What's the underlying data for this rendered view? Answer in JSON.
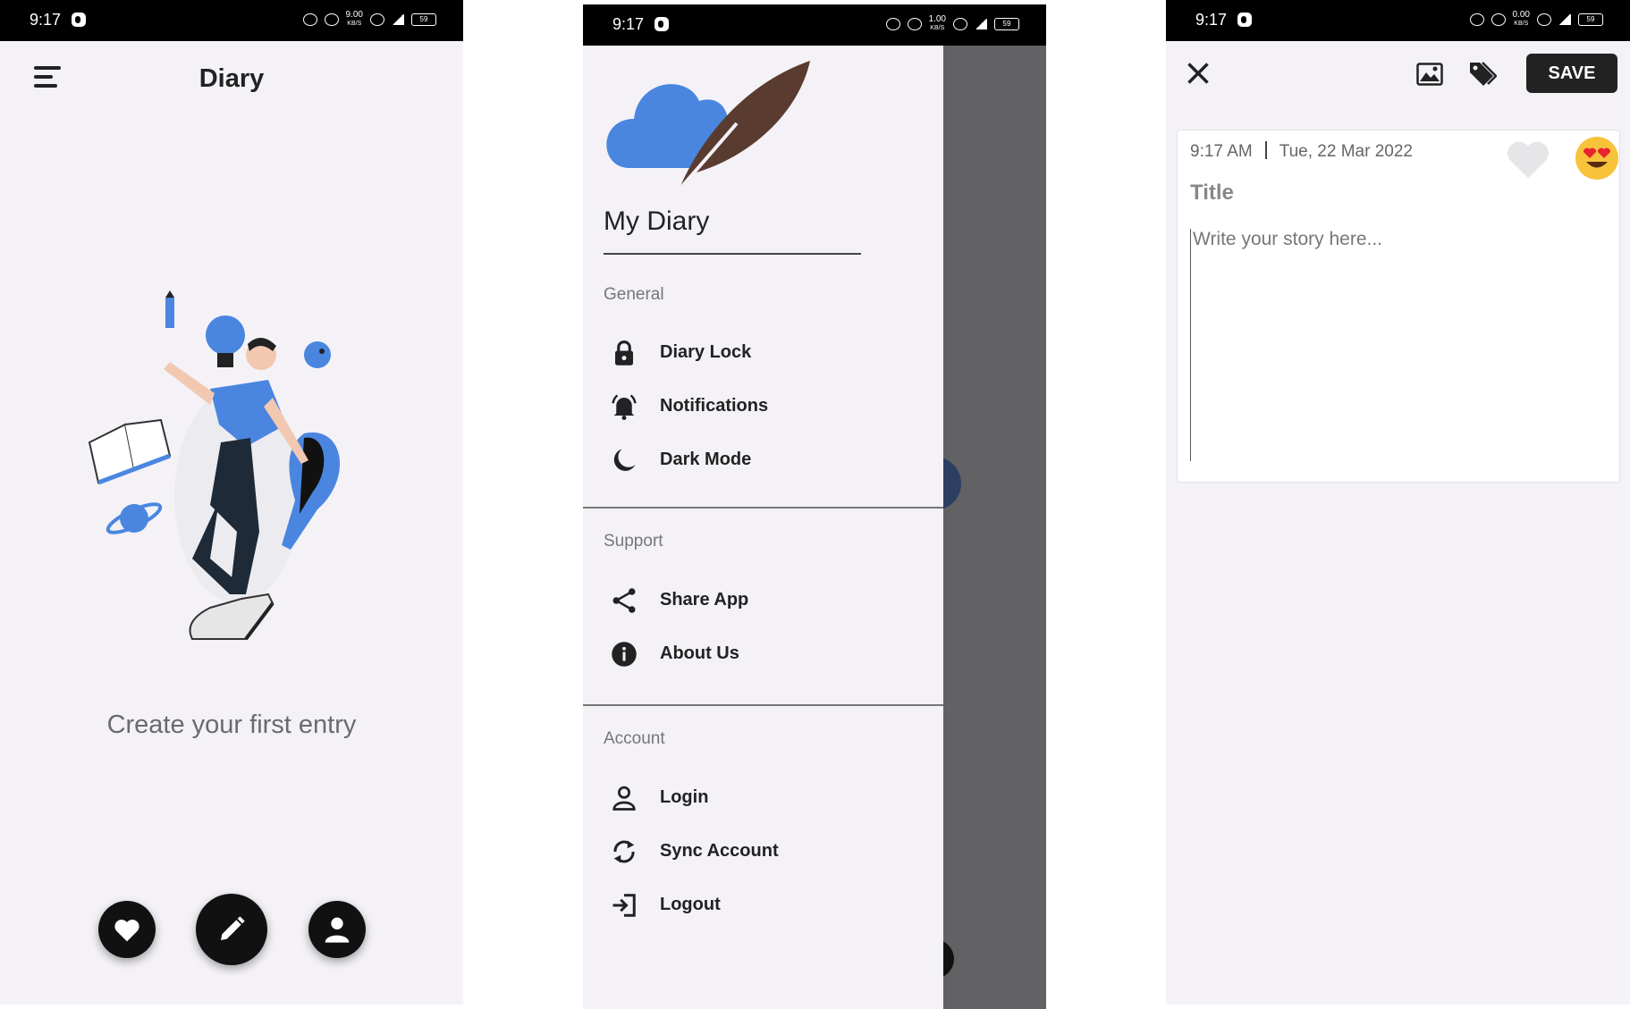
{
  "status_bar": [
    {
      "time": "9:17",
      "speed": "9.00",
      "battery": "59"
    },
    {
      "time": "9:17",
      "speed": "1.00",
      "battery": "59"
    },
    {
      "time": "9:17",
      "speed": "0.00",
      "battery": "59"
    }
  ],
  "status_bar_unit": "KB/S",
  "home": {
    "title": "Diary",
    "empty_message": "Create your first entry",
    "fab_icons": [
      "heart-icon",
      "pencil-icon",
      "user-icon"
    ]
  },
  "drawer": {
    "app_name": "My Diary",
    "sections": [
      {
        "label": "General",
        "items": [
          {
            "label": "Diary Lock",
            "icon": "lock-icon"
          },
          {
            "label": "Notifications",
            "icon": "bell-icon"
          },
          {
            "label": "Dark Mode",
            "icon": "moon-icon"
          }
        ]
      },
      {
        "label": "Support",
        "items": [
          {
            "label": "Share App",
            "icon": "share-icon"
          },
          {
            "label": "About Us",
            "icon": "info-icon"
          }
        ]
      },
      {
        "label": "Account",
        "items": [
          {
            "label": "Login",
            "icon": "person-icon"
          },
          {
            "label": "Sync Account",
            "icon": "sync-icon"
          },
          {
            "label": "Logout",
            "icon": "logout-icon"
          }
        ]
      }
    ]
  },
  "editor": {
    "save_label": "SAVE",
    "time": "9:17 AM",
    "date": "Tue, 22 Mar 2022",
    "title_placeholder": "Title",
    "story_placeholder": "Write your story here..."
  },
  "colors": {
    "background": "#f4f2f7",
    "accent_blue": "#4a86e0",
    "feather_brown": "#5a3b30",
    "dark": "#111111",
    "scrim": "#626265"
  }
}
